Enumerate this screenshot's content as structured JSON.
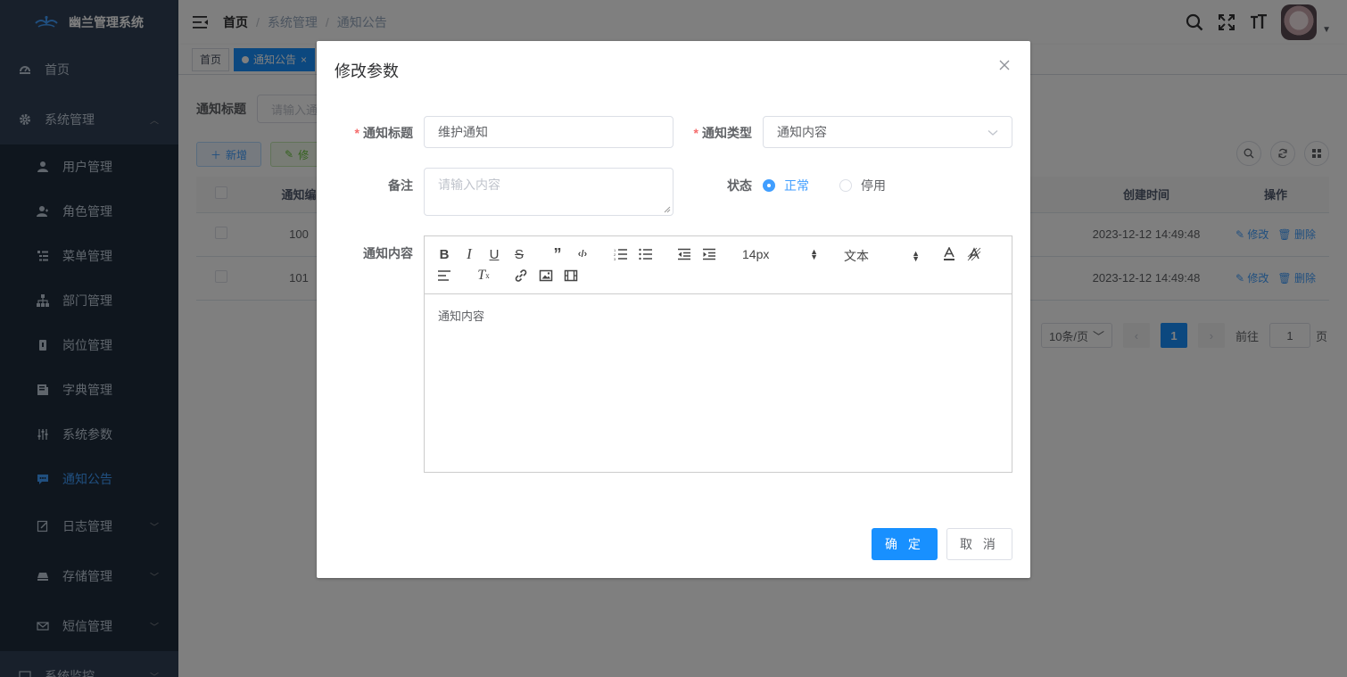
{
  "app": {
    "title": "幽兰管理系统"
  },
  "sidebar": {
    "items": [
      {
        "label": "首页",
        "icon": "dashboard-icon"
      },
      {
        "label": "系统管理",
        "icon": "gear-icon",
        "expanded": true
      },
      {
        "label": "用户管理",
        "icon": "user-icon"
      },
      {
        "label": "角色管理",
        "icon": "role-icon"
      },
      {
        "label": "菜单管理",
        "icon": "tree-table-icon"
      },
      {
        "label": "部门管理",
        "icon": "tree-icon"
      },
      {
        "label": "岗位管理",
        "icon": "post-icon"
      },
      {
        "label": "字典管理",
        "icon": "dict-icon"
      },
      {
        "label": "系统参数",
        "icon": "edit-icon"
      },
      {
        "label": "通知公告",
        "icon": "message-icon",
        "active": true
      },
      {
        "label": "日志管理",
        "icon": "log-icon"
      },
      {
        "label": "存储管理",
        "icon": "storage-icon"
      },
      {
        "label": "短信管理",
        "icon": "mail-icon"
      },
      {
        "label": "系统监控",
        "icon": "monitor-icon"
      }
    ]
  },
  "header": {
    "breadcrumb": [
      "首页",
      "系统管理",
      "通知公告"
    ]
  },
  "tags": {
    "home": "首页",
    "active": "通知公告",
    "active_close": "×"
  },
  "main": {
    "search_label": "通知标题",
    "search_placeholder": "请输入通",
    "add_button": "新增",
    "edit_button": "修",
    "table": {
      "headers": [
        "通知编",
        "创建时间",
        "操作"
      ],
      "rows": [
        {
          "id": "100",
          "created": "2023-12-12 14:49:48",
          "edit": "修改",
          "delete": "删除"
        },
        {
          "id": "101",
          "created": "2023-12-12 14:49:48",
          "edit": "修改",
          "delete": "删除"
        }
      ]
    },
    "pager": {
      "page_size": "10条/页",
      "current_page": "1",
      "goto_label": "前往",
      "goto_value": "1",
      "page_unit": "页"
    }
  },
  "dialog": {
    "title": "修改参数",
    "close": "×",
    "fields": {
      "title_label": "通知标题",
      "title_value": "维护通知",
      "type_label": "通知类型",
      "type_value": "通知内容",
      "remark_label": "备注",
      "remark_placeholder": "请输入内容",
      "status_label": "状态",
      "status_normal": "正常",
      "status_disabled": "停用",
      "status_selected": "正常",
      "content_label": "通知内容"
    },
    "editor": {
      "font_size": "14px",
      "header_select": "文本",
      "content": "通知内容"
    },
    "buttons": {
      "confirm": "确 定",
      "cancel": "取 消"
    }
  },
  "colors": {
    "sidebar_bg": "#304156",
    "submenu_bg": "#1f2d3d",
    "primary": "#1890ff",
    "active_menu": "#409eff",
    "required": "#f56c6c"
  }
}
